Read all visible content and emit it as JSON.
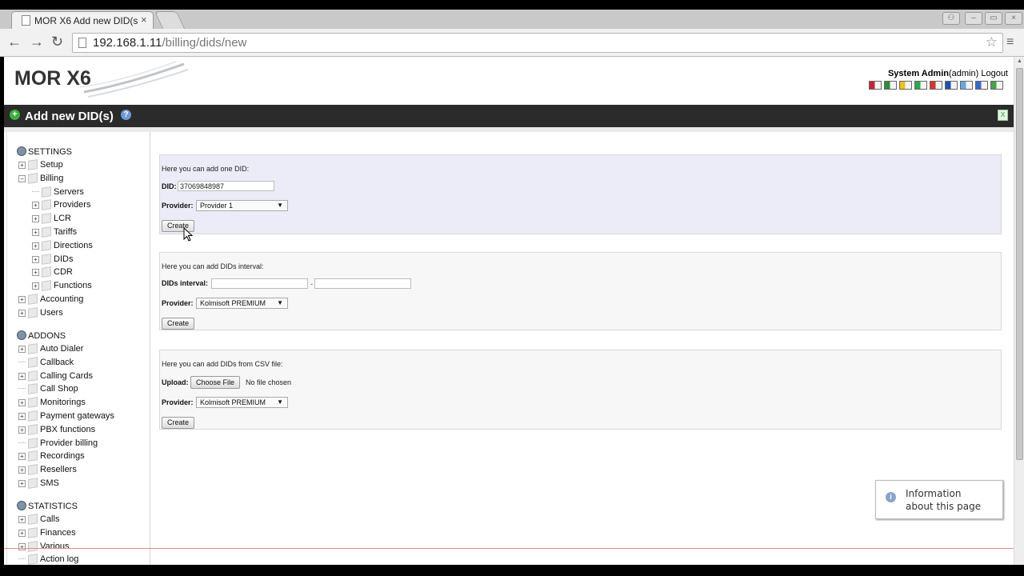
{
  "browser": {
    "tab_title": "MOR X6 Add new DID(s",
    "tab_close": "×",
    "url_host": "192.168.1.11",
    "url_path": "/billing/dids/new",
    "back": "←",
    "forward": "→",
    "reload": "↻",
    "star": "☆",
    "menu": "≡",
    "win_user": "⚇",
    "win_min": "–",
    "win_max": "▭",
    "win_close": "×"
  },
  "header": {
    "logo": "MOR X6",
    "user_name": "System Admin",
    "user_login": "(admin)",
    "logout": "Logout",
    "flags": [
      "#c0263a",
      "#2e8b3c",
      "#e8c227",
      "#2aa84a",
      "#d23a2a",
      "#2250b0",
      "#6aa6e0",
      "#3a6ac8",
      "#4aa04a"
    ]
  },
  "title": {
    "text": "Add new DID(s)",
    "add_glyph": "+",
    "help_glyph": "?",
    "xls_glyph": "X"
  },
  "sidebar": {
    "settings_label": "SETTINGS",
    "settings_items": [
      "Setup",
      "Billing",
      "Servers",
      "Providers",
      "LCR",
      "Tariffs",
      "Directions",
      "DIDs",
      "CDR",
      "Functions",
      "Accounting",
      "Users"
    ],
    "addons_label": "ADDONS",
    "addons_items": [
      "Auto Dialer",
      "Callback",
      "Calling Cards",
      "Call Shop",
      "Monitorings",
      "Payment gateways",
      "PBX functions",
      "Provider billing",
      "Recordings",
      "Resellers",
      "SMS"
    ],
    "statistics_label": "STATISTICS",
    "statistics_items": [
      "Calls",
      "Finances",
      "Various",
      "Action log"
    ],
    "plus": "+",
    "minus": "−"
  },
  "form_single": {
    "intro": "Here you can add one DID:",
    "did_label": "DID:",
    "did_value": "37069848987",
    "provider_label": "Provider:",
    "provider_value": "Provider 1",
    "create_label": "Create"
  },
  "form_interval": {
    "intro": "Here you can add DIDs interval:",
    "interval_label": "DIDs interval:",
    "from_value": "",
    "to_value": "",
    "dash": "-",
    "provider_label": "Provider:",
    "provider_value": "Kolmisoft PREMIUM",
    "create_label": "Create"
  },
  "form_csv": {
    "intro": "Here you can add DIDs from CSV file:",
    "upload_label": "Upload:",
    "choose_file_label": "Choose File",
    "no_file_text": "No file chosen",
    "provider_label": "Provider:",
    "provider_value": "Kolmisoft PREMIUM",
    "create_label": "Create"
  },
  "info_tooltip": {
    "line1": "Information",
    "line2": "about this page",
    "icon": "i"
  }
}
